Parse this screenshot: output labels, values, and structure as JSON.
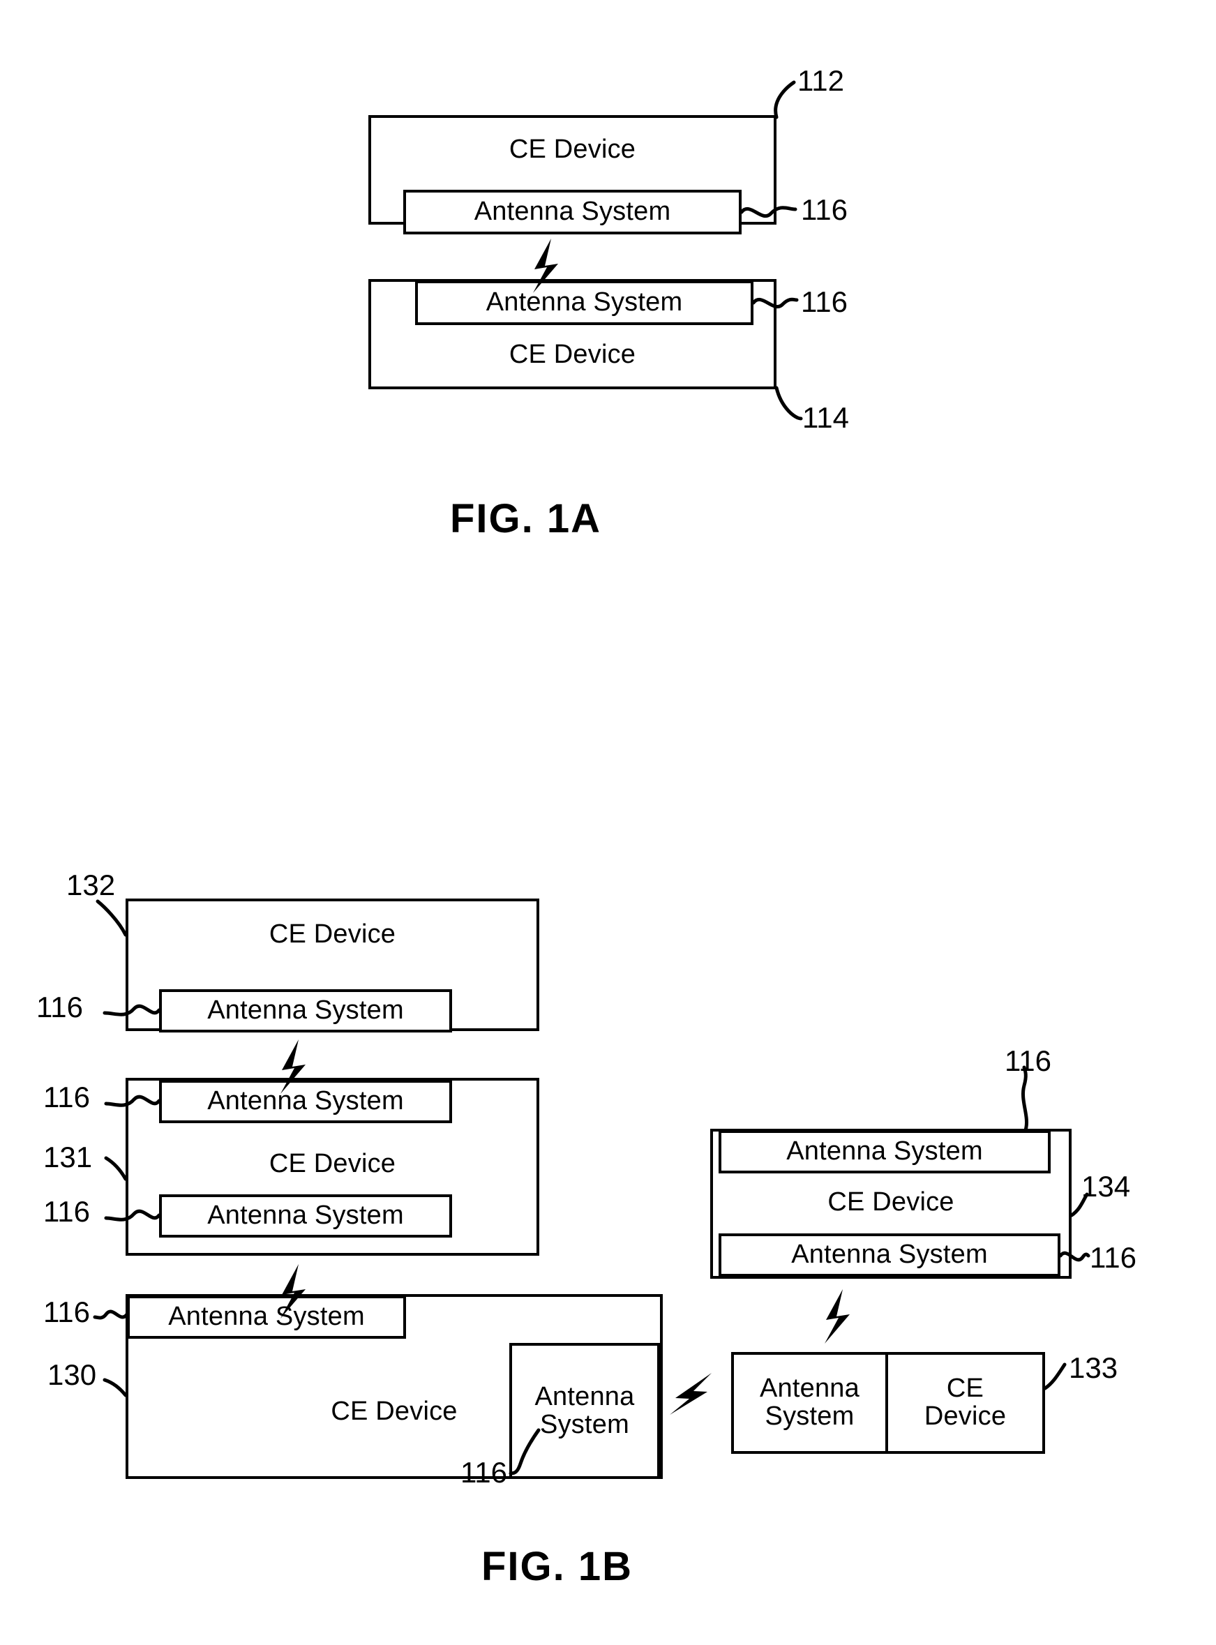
{
  "document": {
    "kind": "patent-drawing-sheet",
    "text_ce_device": "CE Device",
    "text_antenna_system": "Antenna System",
    "text_antenna": "Antenna",
    "text_system": "System",
    "text_ce": "CE",
    "text_device": "Device"
  },
  "figures": [
    {
      "id": "fig-1a",
      "caption": "FIG.  1A",
      "devices": [
        {
          "ref": "112",
          "outer_label": "CE Device",
          "inner_labels": [
            "Antenna System"
          ],
          "inner_ref": "116"
        },
        {
          "ref": "114",
          "outer_label": "CE Device",
          "inner_labels": [
            "Antenna System"
          ],
          "inner_ref": "116"
        }
      ],
      "links": 1
    },
    {
      "id": "fig-1b",
      "caption": "FIG.  1B",
      "devices": [
        {
          "ref": "132",
          "outer_label": "CE Device",
          "inner_labels": [
            "Antenna System"
          ],
          "inner_refs": [
            "116"
          ]
        },
        {
          "ref": "131",
          "outer_label": "CE Device",
          "inner_labels": [
            "Antenna System",
            "Antenna System"
          ],
          "inner_refs": [
            "116",
            "116"
          ]
        },
        {
          "ref": "130",
          "outer_label": "CE Device",
          "inner_labels": [
            "Antenna System",
            "Antenna System"
          ],
          "inner_refs": [
            "116",
            "116"
          ]
        },
        {
          "ref": "134",
          "outer_label": "CE Device",
          "inner_labels": [
            "Antenna System",
            "Antenna System"
          ],
          "inner_refs": [
            "116",
            "116"
          ]
        },
        {
          "ref": "133",
          "outer_label": "CE Device",
          "inner_labels": [
            "Antenna System"
          ],
          "inner_refs": []
        }
      ],
      "links": 4
    }
  ],
  "fig1a": {
    "caption": "FIG.  1A",
    "top_device": {
      "ref": "112",
      "name": "CE Device",
      "antenna": {
        "name": "Antenna System",
        "ref": "116"
      }
    },
    "bottom_device": {
      "ref": "114",
      "name": "CE Device",
      "antenna": {
        "name": "Antenna System",
        "ref": "116"
      }
    }
  },
  "fig1b": {
    "caption": "FIG.  1B",
    "dev132": {
      "ref": "132",
      "name": "CE Device",
      "antenna_bottom": {
        "name": "Antenna System",
        "ref": "116"
      }
    },
    "dev131": {
      "ref": "131",
      "name": "CE Device",
      "antenna_top": {
        "name": "Antenna System",
        "ref": "116"
      },
      "antenna_bottom": {
        "name": "Antenna System",
        "ref": "116"
      }
    },
    "dev130": {
      "ref": "130",
      "name": "CE Device",
      "antenna_top": {
        "name": "Antenna System",
        "ref": "116"
      },
      "antenna_right": {
        "line1": "Antenna",
        "line2": "System",
        "ref": "116"
      }
    },
    "dev134": {
      "ref": "134",
      "name": "CE Device",
      "antenna_top": {
        "name": "Antenna System",
        "ref": "116"
      },
      "antenna_bottom": {
        "name": "Antenna System",
        "ref": "116"
      }
    },
    "dev133": {
      "ref": "133",
      "antenna": {
        "line1": "Antenna",
        "line2": "System"
      },
      "device": {
        "line1": "CE",
        "line2": "Device"
      }
    }
  }
}
